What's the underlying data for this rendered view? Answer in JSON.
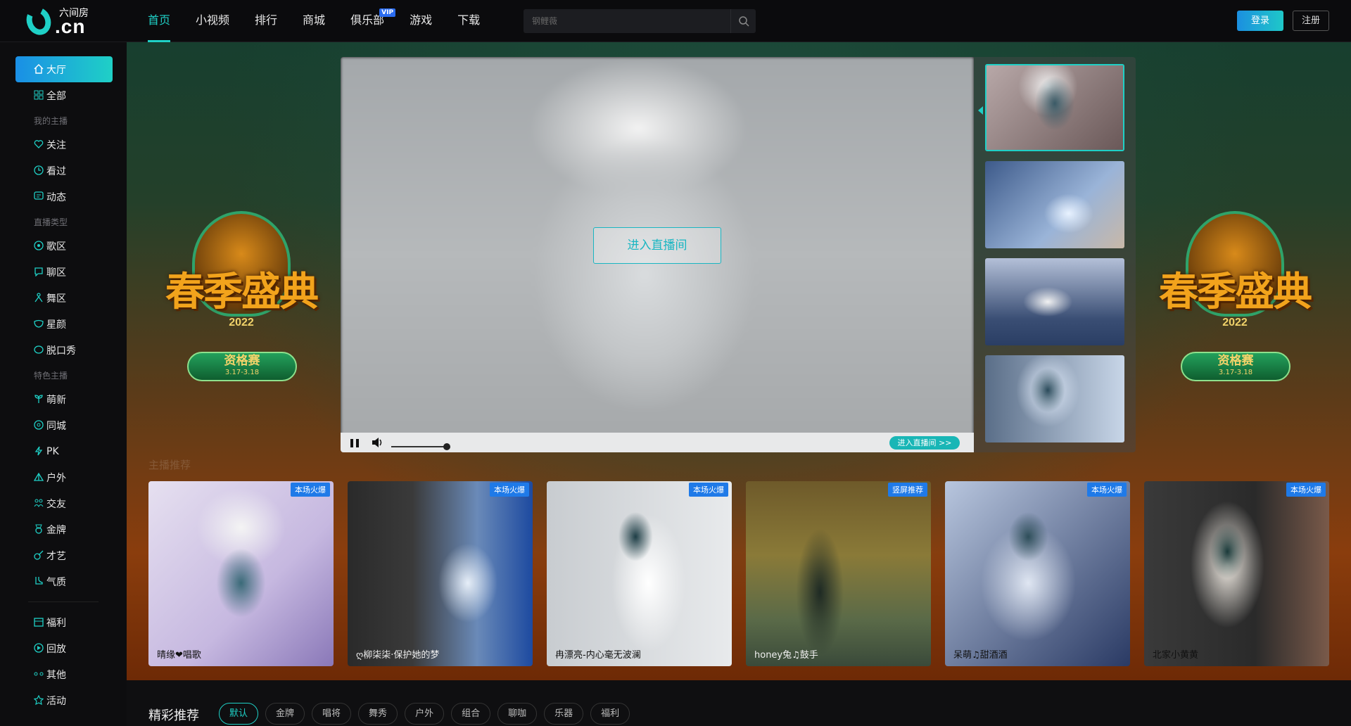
{
  "logo": {
    "name": "六间房",
    "domain": ".cn"
  },
  "nav": [
    {
      "label": "首页",
      "active": true
    },
    {
      "label": "小视频"
    },
    {
      "label": "排行"
    },
    {
      "label": "商城"
    },
    {
      "label": "俱乐部",
      "badge": "VIP"
    },
    {
      "label": "游戏"
    },
    {
      "label": "下载"
    }
  ],
  "search": {
    "placeholder": "钢鲤薇"
  },
  "auth": {
    "login": "登录",
    "register": "注册"
  },
  "sidebar": {
    "top": [
      {
        "label": "大厅",
        "icon": "home-icon",
        "active": true
      },
      {
        "label": "全部",
        "icon": "grid-icon"
      }
    ],
    "my_head": "我的主播",
    "my": [
      {
        "label": "关注",
        "icon": "heart-icon"
      },
      {
        "label": "看过",
        "icon": "clock-icon"
      },
      {
        "label": "动态",
        "icon": "chat-icon"
      }
    ],
    "type_head": "直播类型",
    "types": [
      {
        "label": "歌区",
        "icon": "music-disc-icon"
      },
      {
        "label": "聊区",
        "icon": "chat-bubble-icon"
      },
      {
        "label": "舞区",
        "icon": "dancer-icon"
      },
      {
        "label": "星颜",
        "icon": "mask-icon"
      },
      {
        "label": "脱口秀",
        "icon": "talk-icon"
      }
    ],
    "feature_head": "特色主播",
    "features": [
      {
        "label": "萌新",
        "icon": "sprout-icon"
      },
      {
        "label": "同城",
        "icon": "location-icon"
      },
      {
        "label": "PK",
        "icon": "lightning-icon"
      },
      {
        "label": "户外",
        "icon": "tent-icon"
      },
      {
        "label": "交友",
        "icon": "people-icon"
      },
      {
        "label": "金牌",
        "icon": "medal-icon"
      },
      {
        "label": "才艺",
        "icon": "guitar-icon"
      },
      {
        "label": "气质",
        "icon": "boot-icon"
      }
    ],
    "more": [
      {
        "label": "福利",
        "icon": "gift-box-icon"
      },
      {
        "label": "回放",
        "icon": "replay-icon"
      },
      {
        "label": "其他",
        "icon": "dots-icon"
      },
      {
        "label": "活动",
        "icon": "star-icon"
      }
    ]
  },
  "hero": {
    "emblem_title": "春季盛典",
    "emblem_year": "2022",
    "emblem_badge": "资格赛",
    "emblem_date": "3.17-3.18",
    "enter_button": "进入直播间",
    "enter_small": "进入直播间 >>",
    "volume": 0.8
  },
  "row_label": "主播推荐",
  "cards": [
    {
      "name": "晴缘❤唱歌",
      "tag": "本场火爆"
    },
    {
      "name": "ღ柳柒柒·保护她的梦",
      "tag": "本场火爆"
    },
    {
      "name": "冉漂亮-内心毫无波澜",
      "tag": "本场火爆"
    },
    {
      "name": "honey兔♫鼓手",
      "tag": "竖屏推荐"
    },
    {
      "name": "呆萌♫甜酒酒",
      "tag": "本场火爆"
    },
    {
      "name": "北家小黄黄",
      "tag": "本场火爆"
    }
  ],
  "recommend": {
    "title": "精彩推荐",
    "filters": [
      "默认",
      "金牌",
      "唱将",
      "舞秀",
      "户外",
      "组合",
      "聊咖",
      "乐器",
      "福利"
    ]
  },
  "colors": {
    "accent": "#1fd0c6",
    "brand_blue": "#1f7ae8"
  }
}
